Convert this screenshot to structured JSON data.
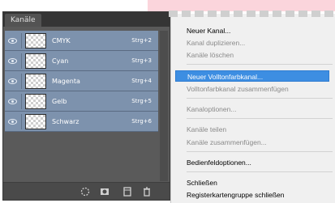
{
  "panel": {
    "tab_label": "Kanäle",
    "channels": [
      {
        "name": "CMYK",
        "shortcut": "Strg+2"
      },
      {
        "name": "Cyan",
        "shortcut": "Strg+3"
      },
      {
        "name": "Magenta",
        "shortcut": "Strg+4"
      },
      {
        "name": "Gelb",
        "shortcut": "Strg+5"
      },
      {
        "name": "Schwarz",
        "shortcut": "Strg+6"
      }
    ]
  },
  "menu": {
    "items": [
      {
        "label": "Neuer Kanal...",
        "disabled": false
      },
      {
        "label": "Kanal duplizieren...",
        "disabled": true
      },
      {
        "label": "Kanäle löschen",
        "disabled": true
      },
      {
        "label": "Neuer Volltonfarbkanal...",
        "disabled": false,
        "highlighted": true
      },
      {
        "label": "Volltonfarbkanal zusammenfügen",
        "disabled": true
      },
      {
        "label": "Kanaloptionen...",
        "disabled": true
      },
      {
        "label": "Kanäle teilen",
        "disabled": true
      },
      {
        "label": "Kanäle zusammenfügen...",
        "disabled": true
      },
      {
        "label": "Bedienfeldoptionen...",
        "disabled": false
      },
      {
        "label": "Schließen",
        "disabled": false
      },
      {
        "label": "Registerkartengruppe schließen",
        "disabled": false
      }
    ]
  }
}
